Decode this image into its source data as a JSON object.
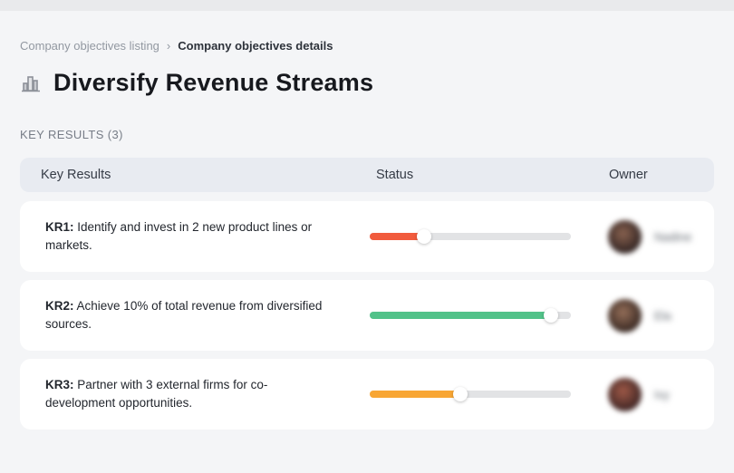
{
  "page": {
    "background": "#f4f5f7",
    "top_strip_color": "#e9eaec"
  },
  "breadcrumb": {
    "separator": "›",
    "items": [
      {
        "label": "Company objectives listing"
      },
      {
        "label": "Company objectives details"
      }
    ]
  },
  "header": {
    "icon": "buildings-icon",
    "title": "Diversify Revenue Streams"
  },
  "section": {
    "label": "KEY RESULTS (3)"
  },
  "table": {
    "columns": [
      "Key Results",
      "Status",
      "Owner"
    ],
    "rows": [
      {
        "kr": "KR1:",
        "text": "Identify and invest in 2 new product lines or markets.",
        "progress_percent": 27,
        "progress_color": "#f15b3d",
        "owner": {
          "name": "Nadine",
          "avatar_colors": [
            "#8a6350",
            "#2c2020"
          ]
        }
      },
      {
        "kr": "KR2:",
        "text": "Achieve 10% of total revenue from diversified sources.",
        "progress_percent": 90,
        "progress_color": "#52c289",
        "owner": {
          "name": "Ela",
          "avatar_colors": [
            "#96705a",
            "#33241f"
          ]
        }
      },
      {
        "kr": "KR3:",
        "text": "Partner with 3 external firms for co-development opportunities.",
        "progress_percent": 45,
        "progress_color": "#f8a634",
        "owner": {
          "name": "Ivy",
          "avatar_colors": [
            "#a05a48",
            "#392222"
          ]
        }
      }
    ]
  }
}
